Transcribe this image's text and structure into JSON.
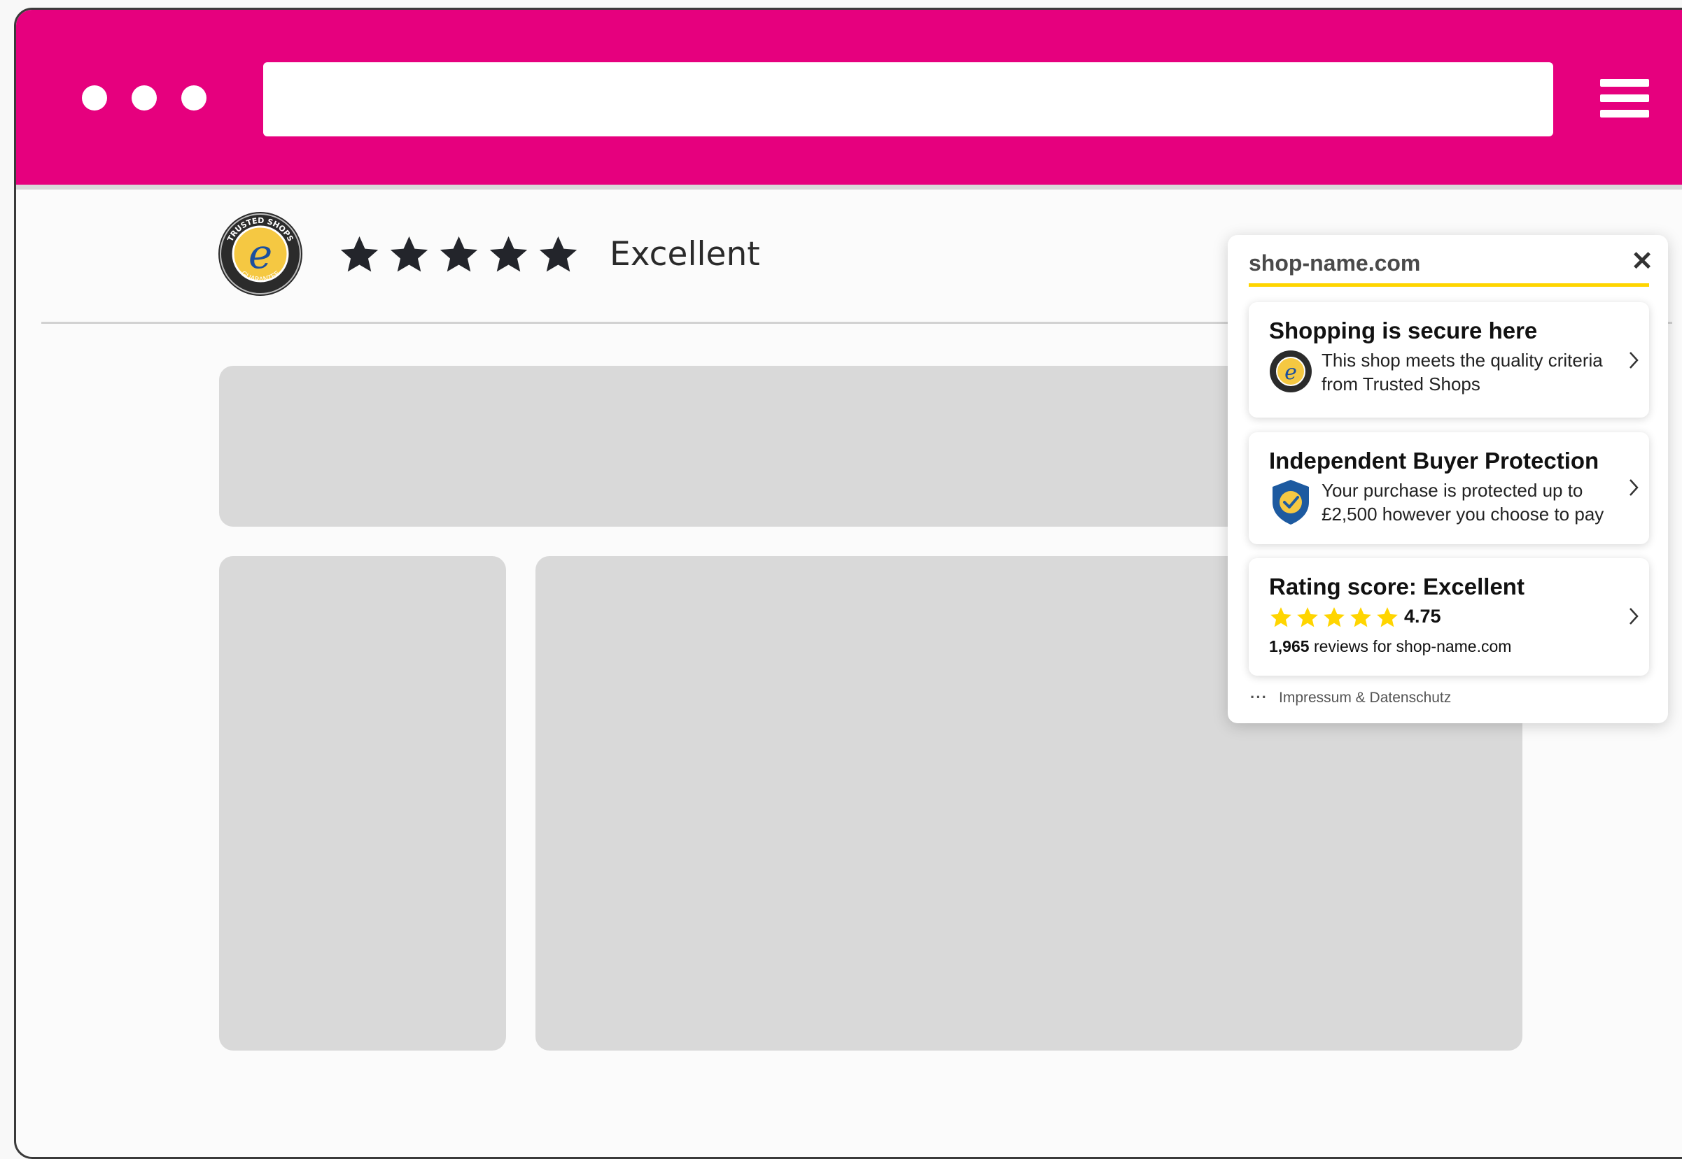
{
  "browser": {
    "window_dots": [
      "dot",
      "dot",
      "dot"
    ],
    "address_bar": {
      "value": ""
    },
    "menu_icon": "hamburger-menu-icon",
    "accent_color": "#e6007e"
  },
  "header": {
    "seal_text_top": "TRUSTED SHOPS",
    "seal_text_bottom": "GUARANTEE",
    "seal_letter": "e",
    "stars": 5,
    "rating_word": "Excellent"
  },
  "popup": {
    "domain": "shop-name.com",
    "close_symbol": "✕",
    "cards": [
      {
        "title": "Shopping is secure here",
        "text": "This shop meets the quality criteria from Trusted Shops",
        "icon": "trusted-shops-seal-icon"
      },
      {
        "title": "Independent Buyer Protection",
        "text": "Your purchase is protected up to £2,500 however you choose to pay",
        "icon": "shield-check-icon"
      },
      {
        "title": "Rating score: Excellent",
        "stars": 5,
        "score": "4.75",
        "review_count": "1,965",
        "review_suffix": " reviews for shop-name.com"
      }
    ],
    "footer_dots": "···",
    "footer_link": "Impressum & Datenschutz",
    "highlight_color": "#ffd500"
  }
}
